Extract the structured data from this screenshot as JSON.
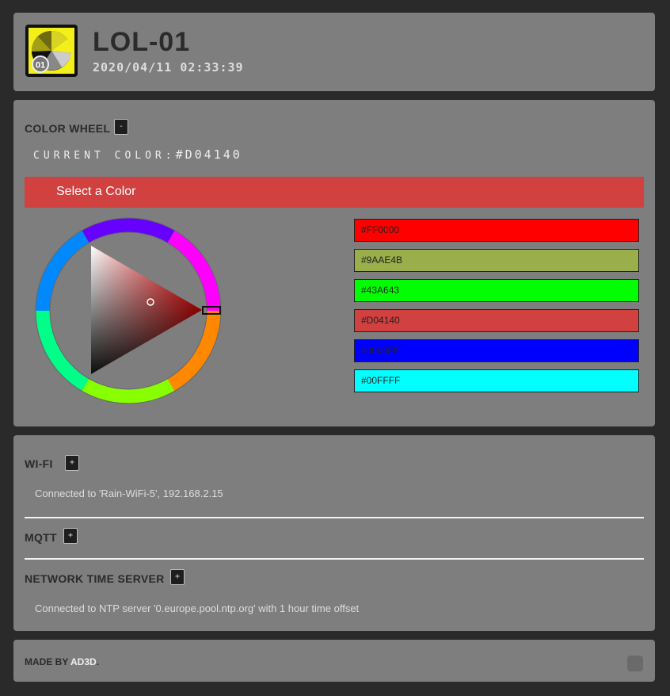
{
  "header": {
    "device_name": "LOL-01",
    "timestamp": "2020/04/11 02:33:39",
    "logo_badge": "01"
  },
  "color_wheel": {
    "title": "COLOR WHEEL",
    "toggle": "-",
    "current_label": "CURRENT COLOR:",
    "current_value": "#D04140",
    "select_label": "Select a Color",
    "swatches": [
      {
        "value": "#FF0000",
        "color": "#ff0000"
      },
      {
        "value": "#9AAE4B",
        "color": "#9aae4b"
      },
      {
        "value": "#43A643",
        "color": "#00ff00"
      },
      {
        "value": "#D04140",
        "color": "#d04140"
      },
      {
        "value": "#0000FF",
        "color": "#0000ff"
      },
      {
        "value": "#00FFFF",
        "color": "#00ffff"
      }
    ]
  },
  "network": {
    "wifi": {
      "title": "WI-FI",
      "toggle": "+",
      "status": "Connected to 'Rain-WiFi-5', 192.168.2.15"
    },
    "mqtt": {
      "title": "MQTT",
      "toggle": "+"
    },
    "ntp": {
      "title": "NETWORK TIME SERVER",
      "toggle": "+",
      "status": "Connected to NTP server '0.europe.pool.ntp.org' with 1 hour time offset"
    }
  },
  "footer": {
    "made_by": "MADE BY",
    "brand": "AD3D",
    "suffix": "."
  }
}
